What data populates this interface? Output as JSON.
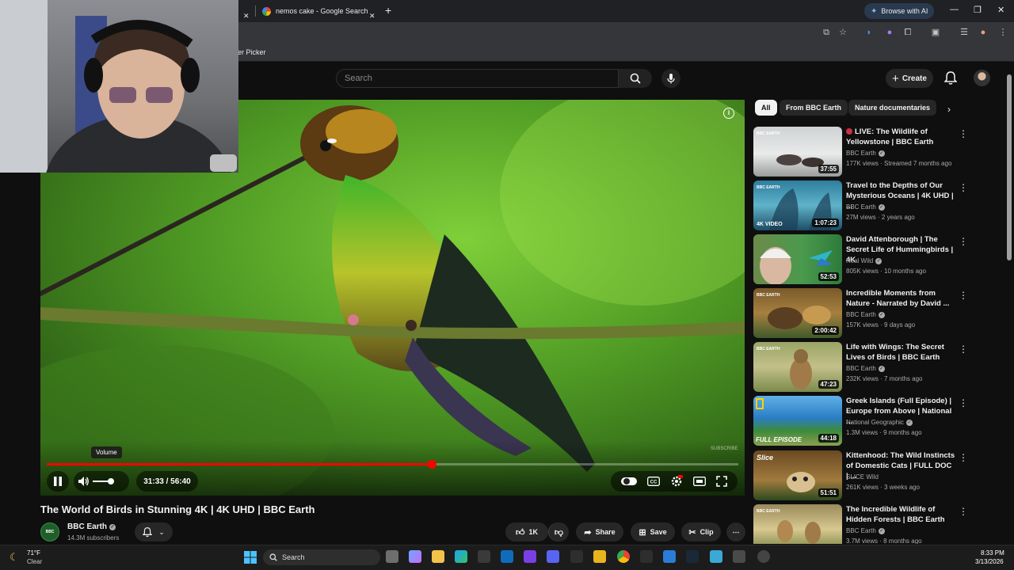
{
  "browser": {
    "tabs": [
      {
        "label": "nemos cake - Google Search"
      }
    ],
    "browse_with_ai": "Browse with AI",
    "bookmark_partial": "er Picker"
  },
  "youtube": {
    "search_placeholder": "Search",
    "create_label": "Create",
    "video": {
      "title": "The World of Birds in Stunning 4K | 4K UHD | BBC Earth",
      "time": "31:33 / 56:40",
      "progress_fraction": 0.557,
      "volume_tooltip": "Volume",
      "watermark": "SUBSCRIBE"
    },
    "channel": {
      "name": "BBC Earth",
      "subscribers": "14.3M subscribers",
      "avatar_text": "BBC EARTH"
    },
    "actions": {
      "likes": "1K",
      "share": "Share",
      "save": "Save",
      "clip": "Clip"
    },
    "chips": [
      "All",
      "From BBC Earth",
      "Nature documentaries"
    ],
    "recommendations": [
      {
        "title": "LIVE: The Wildlife of Yellowstone | BBC Earth",
        "channel": "BBC Earth",
        "meta": "177K views · Streamed 7 months ago",
        "duration": "37:55",
        "live": true
      },
      {
        "title": "Travel to the Depths of Our Mysterious Oceans | 4K UHD | ...",
        "channel": "BBC Earth",
        "meta": "27M views · 2 years ago",
        "duration": "1:07:23",
        "live": false,
        "badge": "4K VIDEO"
      },
      {
        "title": "David Attenborough | The Secret Life of Hummingbirds | 4K",
        "channel": "Real Wild",
        "meta": "805K views · 10 months ago",
        "duration": "52:53",
        "live": false
      },
      {
        "title": "Incredible Moments from Nature - Narrated by David ...",
        "channel": "BBC Earth",
        "meta": "157K views · 9 days ago",
        "duration": "2:00:42",
        "live": false
      },
      {
        "title": "Life with Wings: The Secret Lives of Birds | BBC Earth",
        "channel": "BBC Earth",
        "meta": "232K views · 7 months ago",
        "duration": "47:23",
        "live": false
      },
      {
        "title": "Greek Islands (Full Episode) | Europe from Above | National ...",
        "channel": "National Geographic",
        "meta": "1.3M views · 9 months ago",
        "duration": "44:18",
        "live": false,
        "badge": "FULL EPISODE"
      },
      {
        "title": "Kittenhood: The Wild Instincts of Domestic Cats | FULL DOC | ...",
        "channel": "SLICE Wild",
        "meta": "261K views · 3 weeks ago",
        "duration": "51:51",
        "live": false,
        "badge": "Slice"
      },
      {
        "title": "The Incredible Wildlife of Hidden Forests | BBC Earth",
        "channel": "BBC Earth",
        "meta": "3.7M views · 8 months ago",
        "duration": "",
        "live": false
      }
    ]
  },
  "taskbar": {
    "weather_temp": "71°F",
    "weather_cond": "Clear",
    "search_label": "Search",
    "time": "8:33 PM",
    "date": "3/13/2026"
  },
  "colors": {
    "accent_red": "#ff0000",
    "bg": "#0f0f0f",
    "chip_bg": "#272727"
  }
}
